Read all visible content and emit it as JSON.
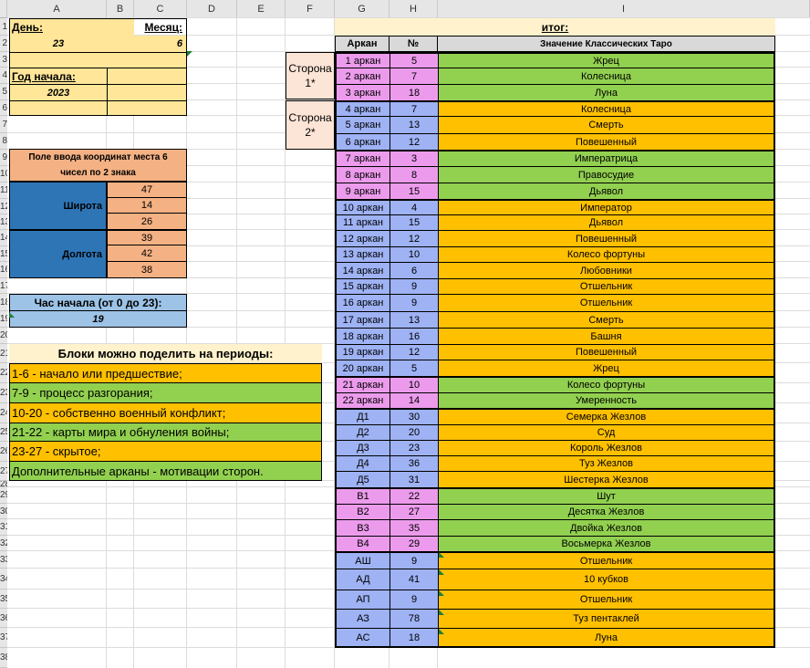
{
  "columns": [
    "A",
    "B",
    "C",
    "D",
    "E",
    "F",
    "G",
    "H",
    "I"
  ],
  "rows": [
    "1",
    "2",
    "3",
    "4",
    "5",
    "6",
    "7",
    "8",
    "9",
    "10",
    "11",
    "12",
    "13",
    "14",
    "15",
    "16",
    "17",
    "18",
    "19",
    "20",
    "21",
    "22",
    "23",
    "24",
    "25",
    "26",
    "27",
    "28",
    "29",
    "30",
    "31",
    "32",
    "33",
    "34",
    "35",
    "36",
    "37",
    "38"
  ],
  "left": {
    "day_label": "День:",
    "month_label": "Месяц:",
    "day_value": "23",
    "month_value": "6",
    "year_label": "Год начала:",
    "year_value": "2023",
    "coords_title_1": "Поле ввода координат места 6",
    "coords_title_2": "чисел по 2 знака",
    "lat_label": "Широта",
    "lon_label": "Долгота",
    "lat_values": [
      "47",
      "14",
      "26"
    ],
    "lon_values": [
      "39",
      "42",
      "38"
    ],
    "hour_label": "Час начала (от 0 до 23):",
    "hour_value": "19",
    "periods_title": "Блоки можно поделить на периоды:",
    "periods": [
      "1-6 - начало или предшествие;",
      "7-9 - процесс разгорания;",
      "10-20 - собственно военный конфликт;",
      "21-22 - карты мира и обнуления войны;",
      "23-27 - скрытое;",
      "Дополнительные арканы - мотивации сторон."
    ]
  },
  "side1": "Сторона 1*",
  "side2": "Сторона 2*",
  "result": {
    "title": "итог:",
    "col_arcana": "Аркан",
    "col_num": "№",
    "col_meaning": "Значение Классических Таро",
    "rows": [
      {
        "a": "1 аркан",
        "n": "5",
        "m": "Жрец"
      },
      {
        "a": "2 аркан",
        "n": "7",
        "m": "Колесница"
      },
      {
        "a": "3 аркан",
        "n": "18",
        "m": "Луна"
      },
      {
        "a": "4 аркан",
        "n": "7",
        "m": "Колесница"
      },
      {
        "a": "5 аркан",
        "n": "13",
        "m": "Смерть"
      },
      {
        "a": "6 аркан",
        "n": "12",
        "m": "Повешенный"
      },
      {
        "a": "7 аркан",
        "n": "3",
        "m": "Императрица"
      },
      {
        "a": "8 аркан",
        "n": "8",
        "m": "Правосудие"
      },
      {
        "a": "9 аркан",
        "n": "15",
        "m": "Дьявол"
      },
      {
        "a": "10 аркан",
        "n": "4",
        "m": "Император"
      },
      {
        "a": "11 аркан",
        "n": "15",
        "m": "Дьявол"
      },
      {
        "a": "12 аркан",
        "n": "12",
        "m": "Повешенный"
      },
      {
        "a": "13 аркан",
        "n": "10",
        "m": "Колесо фортуны"
      },
      {
        "a": "14 аркан",
        "n": "6",
        "m": "Любовники"
      },
      {
        "a": "15 аркан",
        "n": "9",
        "m": "Отшельник"
      },
      {
        "a": "16 аркан",
        "n": "9",
        "m": "Отшельник"
      },
      {
        "a": "17 аркан",
        "n": "13",
        "m": "Смерть"
      },
      {
        "a": "18 аркан",
        "n": "16",
        "m": "Башня"
      },
      {
        "a": "19 аркан",
        "n": "12",
        "m": "Повешенный"
      },
      {
        "a": "20 аркан",
        "n": "5",
        "m": "Жрец"
      },
      {
        "a": "21 аркан",
        "n": "10",
        "m": "Колесо фортуны"
      },
      {
        "a": "22 аркан",
        "n": "14",
        "m": "Умеренность"
      },
      {
        "a": "Д1",
        "n": "30",
        "m": "Семерка Жезлов"
      },
      {
        "a": "Д2",
        "n": "20",
        "m": "Суд"
      },
      {
        "a": "Д3",
        "n": "23",
        "m": "Король Жезлов"
      },
      {
        "a": "Д4",
        "n": "36",
        "m": "Туз Жезлов"
      },
      {
        "a": "Д5",
        "n": "31",
        "m": "Шестерка Жезлов"
      },
      {
        "a": "В1",
        "n": "22",
        "m": "Шут"
      },
      {
        "a": "В2",
        "n": "27",
        "m": "Десятка Жезлов"
      },
      {
        "a": "В3",
        "n": "35",
        "m": "Двойка Жезлов"
      },
      {
        "a": "В4",
        "n": "29",
        "m": "Восьмерка Жезлов"
      },
      {
        "a": "АШ",
        "n": "9",
        "m": "Отшельник"
      },
      {
        "a": "АД",
        "n": "41",
        "m": "10 кубков"
      },
      {
        "a": "АП",
        "n": "9",
        "m": "Отшельник"
      },
      {
        "a": "АЗ",
        "n": "78",
        "m": "Туз пентаклей"
      },
      {
        "a": "АС",
        "n": "18",
        "m": "Луна"
      }
    ]
  },
  "colors": {
    "yellow": "#ffe699",
    "salmon": "#f4b183",
    "blue": "#2e75b6",
    "lightblue": "#9dc3e6",
    "pink": "#ec9bec",
    "purple": "#9eb2f4",
    "green": "#92d050",
    "orange": "#ffc000"
  }
}
